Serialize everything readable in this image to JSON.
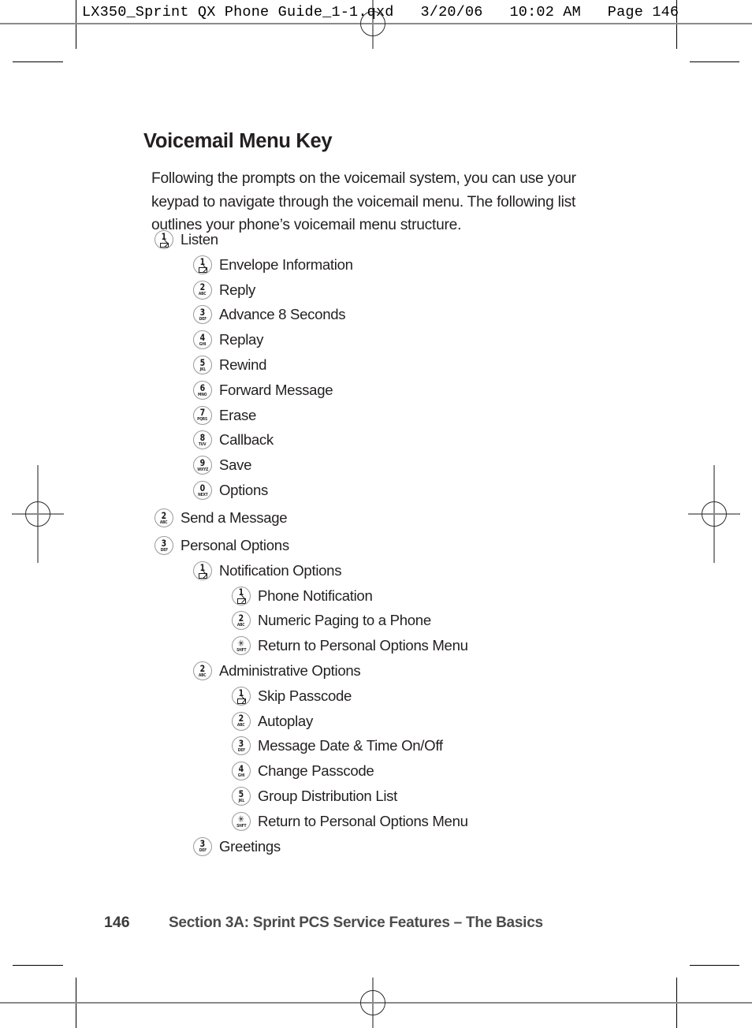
{
  "print_slug": "LX350_Sprint QX Phone Guide_1-1.qxd   3/20/06   10:02 AM   Page 146",
  "page_title": "Voicemail Menu Key",
  "intro_paragraph": "Following the prompts on the voicemail system, you can use your keypad to navigate through the voicemail menu. The following list outlines your phone’s voicemail menu structure.",
  "keys": {
    "1": {
      "num": "1",
      "sub": "envelope-glyph"
    },
    "2": {
      "num": "2",
      "sub": "ABC"
    },
    "3": {
      "num": "3",
      "sub": "DEF"
    },
    "4": {
      "num": "4",
      "sub": "GHI"
    },
    "5": {
      "num": "5",
      "sub": "JKL"
    },
    "6": {
      "num": "6",
      "sub": "MNO"
    },
    "7": {
      "num": "7",
      "sub": "PQRS"
    },
    "8": {
      "num": "8",
      "sub": "TUV"
    },
    "9": {
      "num": "9",
      "sub": "WXYZ"
    },
    "0": {
      "num": "0",
      "sub": "NEXT"
    },
    "star": {
      "num": "✳",
      "sub": "SHFT"
    }
  },
  "menu": [
    {
      "level": 1,
      "key": "1",
      "label": "Listen",
      "gap": false
    },
    {
      "level": 2,
      "key": "1",
      "label": "Envelope Information",
      "gap": false
    },
    {
      "level": 2,
      "key": "2",
      "label": "Reply",
      "gap": false
    },
    {
      "level": 2,
      "key": "3",
      "label": "Advance 8 Seconds",
      "gap": false
    },
    {
      "level": 2,
      "key": "4",
      "label": "Replay",
      "gap": false
    },
    {
      "level": 2,
      "key": "5",
      "label": "Rewind",
      "gap": false
    },
    {
      "level": 2,
      "key": "6",
      "label": "Forward Message",
      "gap": false
    },
    {
      "level": 2,
      "key": "7",
      "label": "Erase",
      "gap": false
    },
    {
      "level": 2,
      "key": "8",
      "label": "Callback",
      "gap": false
    },
    {
      "level": 2,
      "key": "9",
      "label": "Save",
      "gap": false
    },
    {
      "level": 2,
      "key": "0",
      "label": "Options",
      "gap": false
    },
    {
      "level": 1,
      "key": "2",
      "label": "Send a Message",
      "gap": true
    },
    {
      "level": 1,
      "key": "3",
      "label": "Personal Options",
      "gap": true
    },
    {
      "level": 2,
      "key": "1",
      "label": "Notification Options",
      "gap": false
    },
    {
      "level": 3,
      "key": "1",
      "label": "Phone Notification",
      "gap": false
    },
    {
      "level": 3,
      "key": "2",
      "label": "Numeric Paging to a Phone",
      "gap": false
    },
    {
      "level": 3,
      "key": "star",
      "label": "Return to Personal Options Menu",
      "gap": false
    },
    {
      "level": 2,
      "key": "2",
      "label": "Administrative Options",
      "gap": false
    },
    {
      "level": 3,
      "key": "1",
      "label": "Skip Passcode",
      "gap": false
    },
    {
      "level": 3,
      "key": "2",
      "label": "Autoplay",
      "gap": false
    },
    {
      "level": 3,
      "key": "3",
      "label": "Message Date & Time On/Off",
      "gap": false
    },
    {
      "level": 3,
      "key": "4",
      "label": "Change Passcode",
      "gap": false
    },
    {
      "level": 3,
      "key": "5",
      "label": "Group Distribution List",
      "gap": false
    },
    {
      "level": 3,
      "key": "star",
      "label": "Return to Personal Options Menu",
      "gap": false
    },
    {
      "level": 2,
      "key": "3",
      "label": "Greetings",
      "gap": false
    }
  ],
  "footer": {
    "page_number": "146",
    "running_head": "Section 3A: Sprint PCS Service Features – The Basics"
  },
  "colors": {
    "text": "#231f20",
    "footer_text": "#4b4b4b",
    "key_ring": "#9a9a9a",
    "mark": "#000000",
    "reg_line": "#8a8a8a"
  }
}
